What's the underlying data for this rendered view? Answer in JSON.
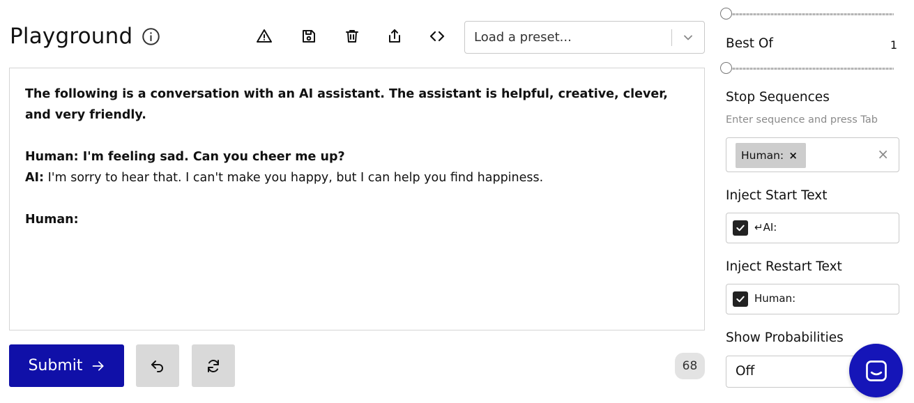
{
  "header": {
    "title": "Playground",
    "toolbar_icons": [
      "warning-icon",
      "save-icon",
      "trash-icon",
      "share-icon",
      "code-icon"
    ],
    "preset_placeholder": "Load a preset..."
  },
  "editor": {
    "intro": "The following is a conversation with an AI assistant. The assistant is helpful, creative, clever, and very friendly.",
    "human_line_1": "Human: I'm feeling sad. Can you cheer me up?",
    "ai_speaker": "AI:",
    "ai_reply": " I'm sorry to hear that. I can't make you happy, but I can help you find happiness.",
    "human_prompt": "Human:"
  },
  "bottom": {
    "submit_label": "Submit",
    "token_count": "68"
  },
  "settings": {
    "top_slider_level": 0,
    "best_of": {
      "label": "Best Of",
      "value": "1",
      "slider_level": 0
    },
    "stop_sequences": {
      "label": "Stop Sequences",
      "hint": "Enter sequence and press Tab",
      "chip": "Human:",
      "chip_remove": "×",
      "clear": "×"
    },
    "inject_start": {
      "label": "Inject Start Text",
      "checked": true,
      "text": "↵AI:"
    },
    "inject_restart": {
      "label": "Inject Restart Text",
      "checked": true,
      "text": "Human:"
    },
    "show_probabilities": {
      "label": "Show Probabilities",
      "value": "Off"
    }
  },
  "colors": {
    "submit_bg": "#1010a8",
    "chat_bubble_bg": "#1515b8",
    "secondary_button_bg": "#d9d9d9"
  }
}
